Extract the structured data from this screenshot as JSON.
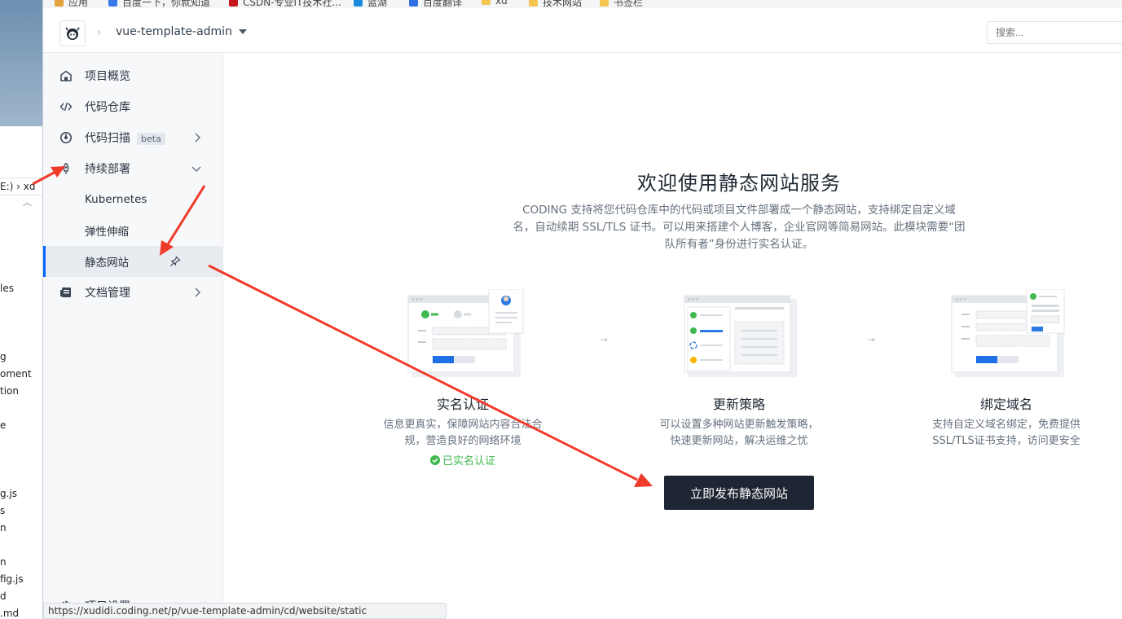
{
  "bookmarks": [
    "应用",
    "百度一下，你就知道",
    "CSDN-专业IT技术社...",
    "蓝湖",
    "百度翻译",
    "xd",
    "技术网站",
    "书签栏"
  ],
  "explorer": {
    "breadcrumb": "E:)  ›  xd",
    "files": [
      "les",
      "g",
      "oment",
      "tion",
      "e",
      "g.js",
      "s",
      "n",
      "n",
      "fig.js",
      "d",
      ".md"
    ]
  },
  "header": {
    "separator": "›",
    "project_name": "vue-template-admin",
    "search_placeholder": "搜索..."
  },
  "sidebar": {
    "items": [
      {
        "label": "项目概览",
        "icon": "home-icon"
      },
      {
        "label": "代码仓库",
        "icon": "code-icon"
      },
      {
        "label": "代码扫描",
        "badge": "beta",
        "icon": "scan-icon"
      },
      {
        "label": "持续部署",
        "icon": "rocket-icon",
        "expanded": true
      },
      {
        "label": "Kubernetes"
      },
      {
        "label": "弹性伸缩"
      },
      {
        "label": "静态网站",
        "active": true
      },
      {
        "label": "文档管理",
        "icon": "docs-icon"
      }
    ],
    "bottom_label": "项目设置"
  },
  "main": {
    "title": "欢迎使用静态网站服务",
    "description": "CODING 支持将您代码仓库中的代码或项目文件部署成一个静态网站，支持绑定自定义域名，自动续期 SSL/TLS 证书。可以用来搭建个人博客，企业官网等简易网站。此模块需要“团队所有者”身份进行实名认证。",
    "steps": [
      {
        "title": "实名认证",
        "desc": "信息更真实，保障网站内容合法合规，营造良好的网络环境",
        "status": "已实名认证"
      },
      {
        "title": "更新策略",
        "desc": "可以设置多种网站更新触发策略，快速更新网站，解决运维之忧"
      },
      {
        "title": "绑定域名",
        "desc": "支持自定义域名绑定，免费提供SSL/TLS证书支持，访问更安全"
      }
    ],
    "step_arrow": "→",
    "publish_button": "立即发布静态网站"
  },
  "status_url": "https://xudidi.coding.net/p/vue-template-admin/cd/website/static",
  "colors": {
    "accent": "#0066ff",
    "button": "#1f2633",
    "success": "#3fb950",
    "annotation": "#f03a2a"
  }
}
